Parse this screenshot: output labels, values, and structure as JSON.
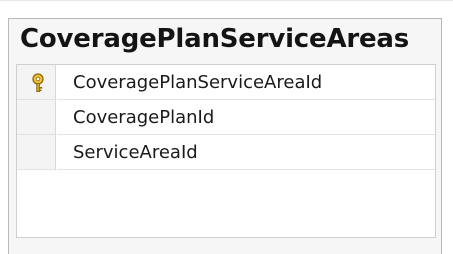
{
  "table": {
    "title": "CoveragePlanServiceAreas",
    "columns": [
      {
        "name": "CoveragePlanServiceAreaId",
        "is_primary_key": true,
        "icon": "primary-key-icon"
      },
      {
        "name": "CoveragePlanId",
        "is_primary_key": false
      },
      {
        "name": "ServiceAreaId",
        "is_primary_key": false
      }
    ]
  },
  "colors": {
    "key_gold": "#d6a21c",
    "key_dark": "#8a6a0c"
  }
}
